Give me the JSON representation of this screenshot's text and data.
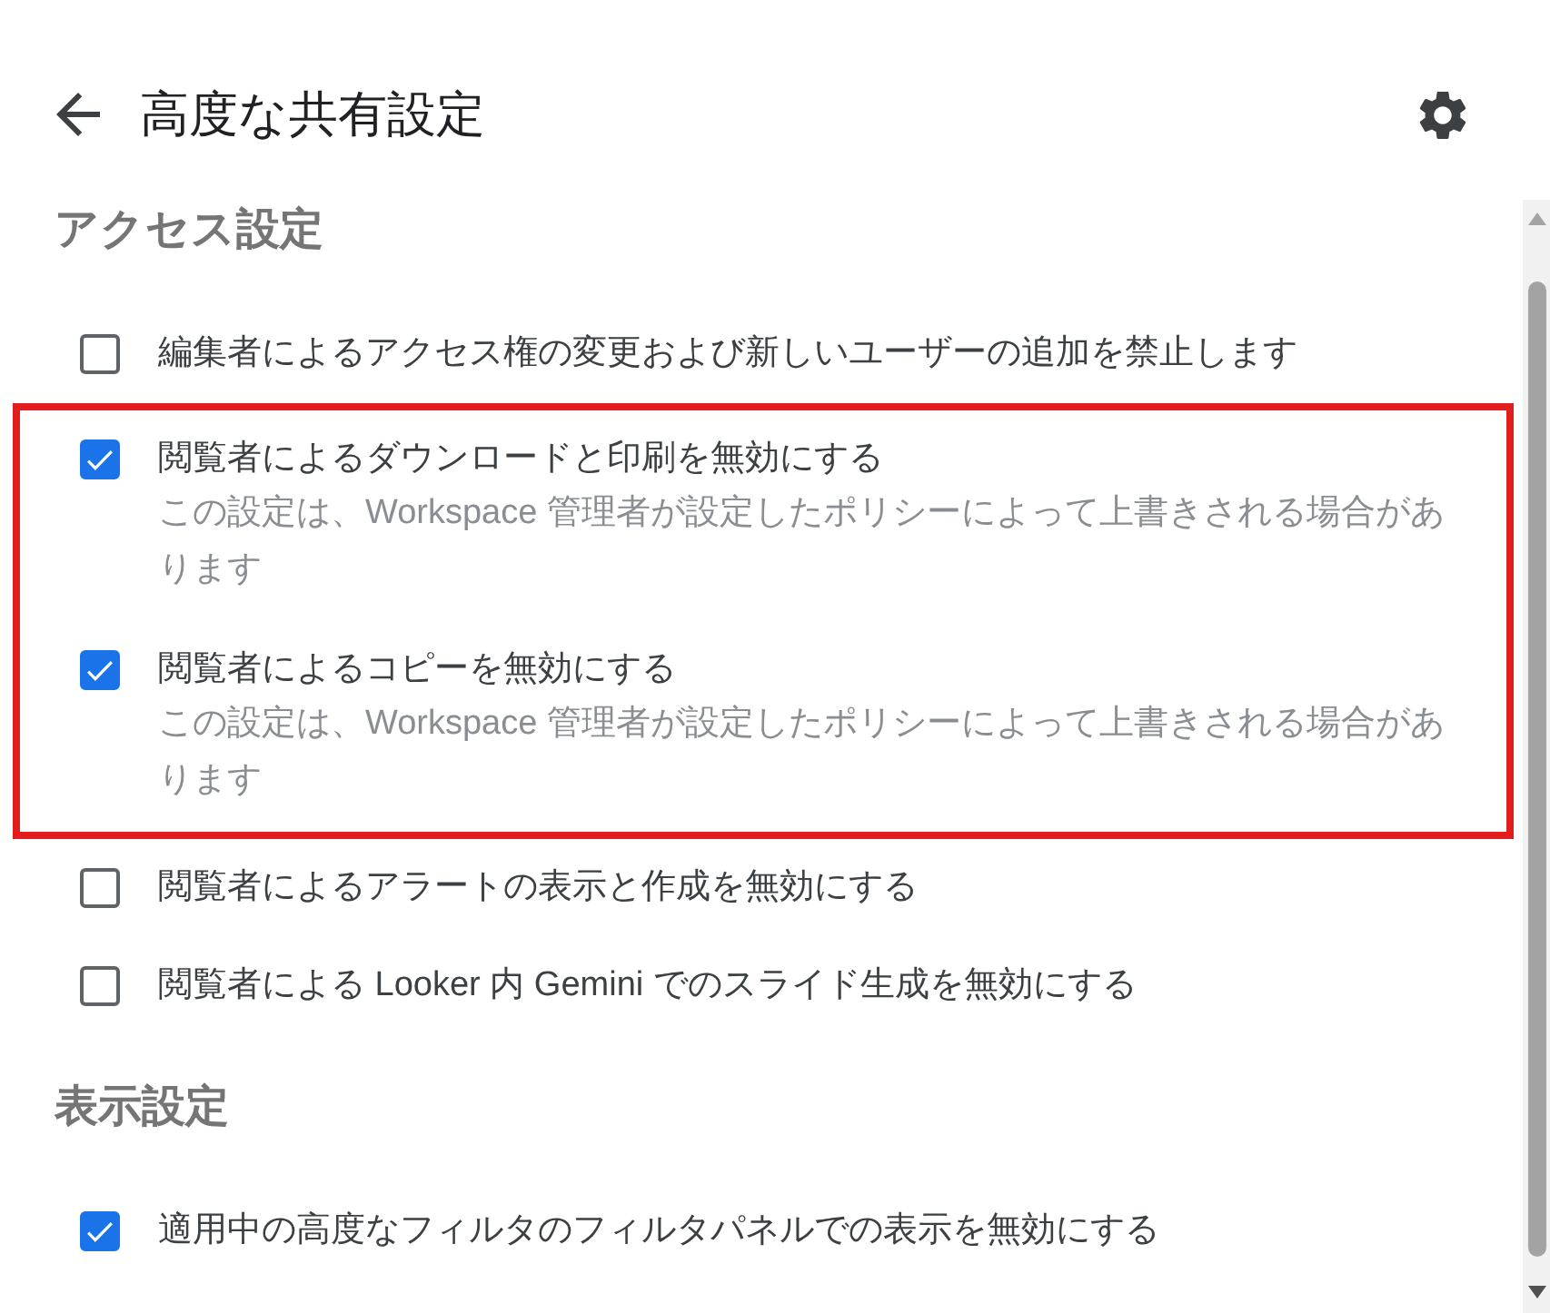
{
  "header": {
    "title": "高度な共有設定"
  },
  "sections": [
    {
      "heading": "アクセス設定",
      "options": [
        {
          "label": "編集者によるアクセス権の変更および新しいユーザーの追加を禁止します",
          "checked": false,
          "highlighted": false
        },
        {
          "label": "閲覧者によるダウンロードと印刷を無効にする",
          "description": "この設定は、Workspace 管理者が設定したポリシーによって上書きされる場合があります",
          "checked": true,
          "highlighted": true
        },
        {
          "label": "閲覧者によるコピーを無効にする",
          "description": "この設定は、Workspace 管理者が設定したポリシーによって上書きされる場合があります",
          "checked": true,
          "highlighted": true
        },
        {
          "label": "閲覧者によるアラートの表示と作成を無効にする",
          "checked": false,
          "highlighted": false
        },
        {
          "label": "閲覧者による Looker 内 Gemini でのスライド生成を無効にする",
          "checked": false,
          "highlighted": false
        }
      ]
    },
    {
      "heading": "表示設定",
      "options": [
        {
          "label": "適用中の高度なフィルタのフィルタパネルでの表示を無効にする",
          "checked": true,
          "highlighted": false
        }
      ]
    }
  ]
}
